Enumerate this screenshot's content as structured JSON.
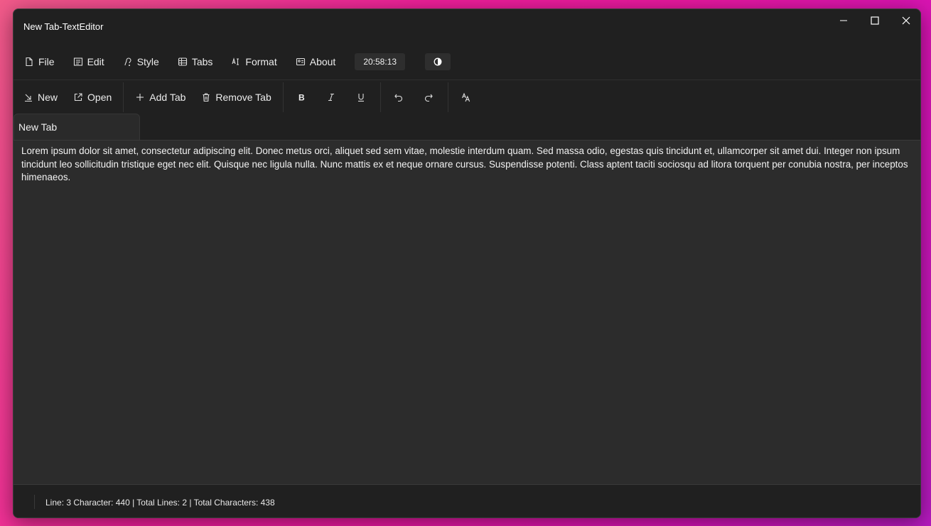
{
  "window": {
    "title": "New Tab-TextEditor"
  },
  "window_controls": [
    "minimize-icon",
    "maximize-icon",
    "close-icon"
  ],
  "menu": {
    "items": [
      {
        "label": "File",
        "icon": "file-icon"
      },
      {
        "label": "Edit",
        "icon": "edit-icon"
      },
      {
        "label": "Style",
        "icon": "style-icon"
      },
      {
        "label": "Tabs",
        "icon": "tabs-icon"
      },
      {
        "label": "Format",
        "icon": "format-icon"
      },
      {
        "label": "About",
        "icon": "about-icon"
      }
    ],
    "clock": "20:58:13",
    "theme_icon": "theme-toggle-icon"
  },
  "toolbar": {
    "new_label": "New",
    "open_label": "Open",
    "add_tab_label": "Add Tab",
    "remove_tab_label": "Remove Tab",
    "icons": [
      "bold-icon",
      "italic-icon",
      "underline-icon",
      "undo-icon",
      "redo-icon",
      "font-size-icon"
    ]
  },
  "tabs": [
    {
      "label": "New Tab"
    }
  ],
  "editor": {
    "content": "Lorem ipsum dolor sit amet, consectetur adipiscing elit. Donec metus orci, aliquet sed sem vitae, molestie interdum quam. Sed massa odio, egestas quis tincidunt et, ullamcorper sit amet dui. Integer non ipsum tincidunt leo sollicitudin tristique eget nec elit. Quisque nec ligula nulla. Nunc mattis ex et neque ornare cursus. Suspendisse potenti. Class aptent taciti sociosqu ad litora torquent per conubia nostra, per inceptos himenaeos."
  },
  "status": {
    "text": "Line: 3 Character: 440 | Total Lines: 2 | Total Characters: 438"
  },
  "colors": {
    "background_accent": "#e8189f",
    "window_bg": "#202020",
    "editor_bg": "#2c2c2c"
  }
}
